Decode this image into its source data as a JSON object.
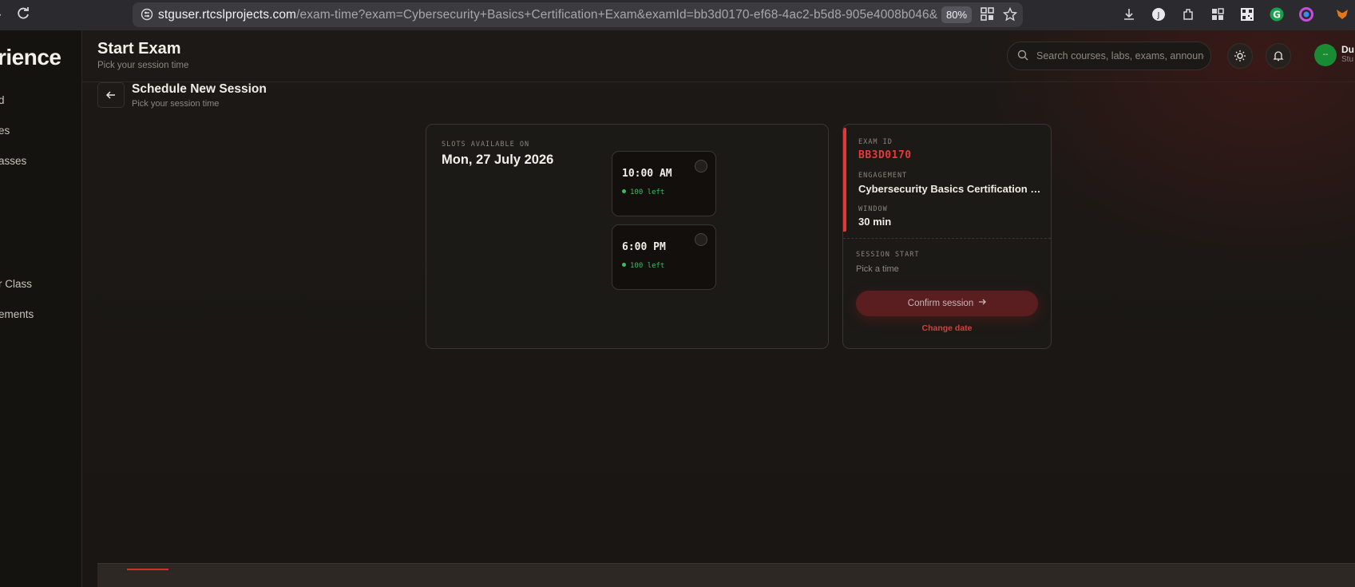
{
  "browser": {
    "url_host": "stguser.rtcslprojects.com",
    "url_path": "/exam-time?exam=Cybersecurity+Basics+Certification+Exam&examId=bb3d0170-ef68-4ac2-b5d8-905e4008b046&",
    "zoom": "80%"
  },
  "sidebar": {
    "brand": "rience",
    "items": [
      {
        "label": "d"
      },
      {
        "label": "es"
      },
      {
        "label": "asses"
      },
      {
        "label": "r Class"
      },
      {
        "label": "ements"
      }
    ]
  },
  "header": {
    "title": "Start Exam",
    "subtitle": "Pick your session time",
    "search_placeholder": "Search courses, labs, exams, announcements",
    "profile_initials": "--",
    "profile_name": "Du",
    "profile_role": "Stu"
  },
  "schedule": {
    "title": "Schedule New Session",
    "subtitle": "Pick your session time"
  },
  "slots": {
    "caption": "SLOTS AVAILABLE ON",
    "date": "Mon, 27 July 2026",
    "items": [
      {
        "time": "10:00 AM",
        "availability": "100 left"
      },
      {
        "time": "6:00 PM",
        "availability": "100 left"
      }
    ]
  },
  "summary": {
    "exam_id_caption": "EXAM ID",
    "exam_id": "BB3D0170",
    "engagement_caption": "ENGAGEMENT",
    "engagement": "Cybersecurity Basics Certification Exam",
    "window_caption": "WINDOW",
    "window": "30 min",
    "session_caption": "SESSION START",
    "session_value": "Pick a time",
    "confirm_label": "Confirm session",
    "change_date_label": "Change date"
  },
  "colors": {
    "accent_red": "#e5393c",
    "available_green": "#3bbd63",
    "background": "#1a1715"
  }
}
